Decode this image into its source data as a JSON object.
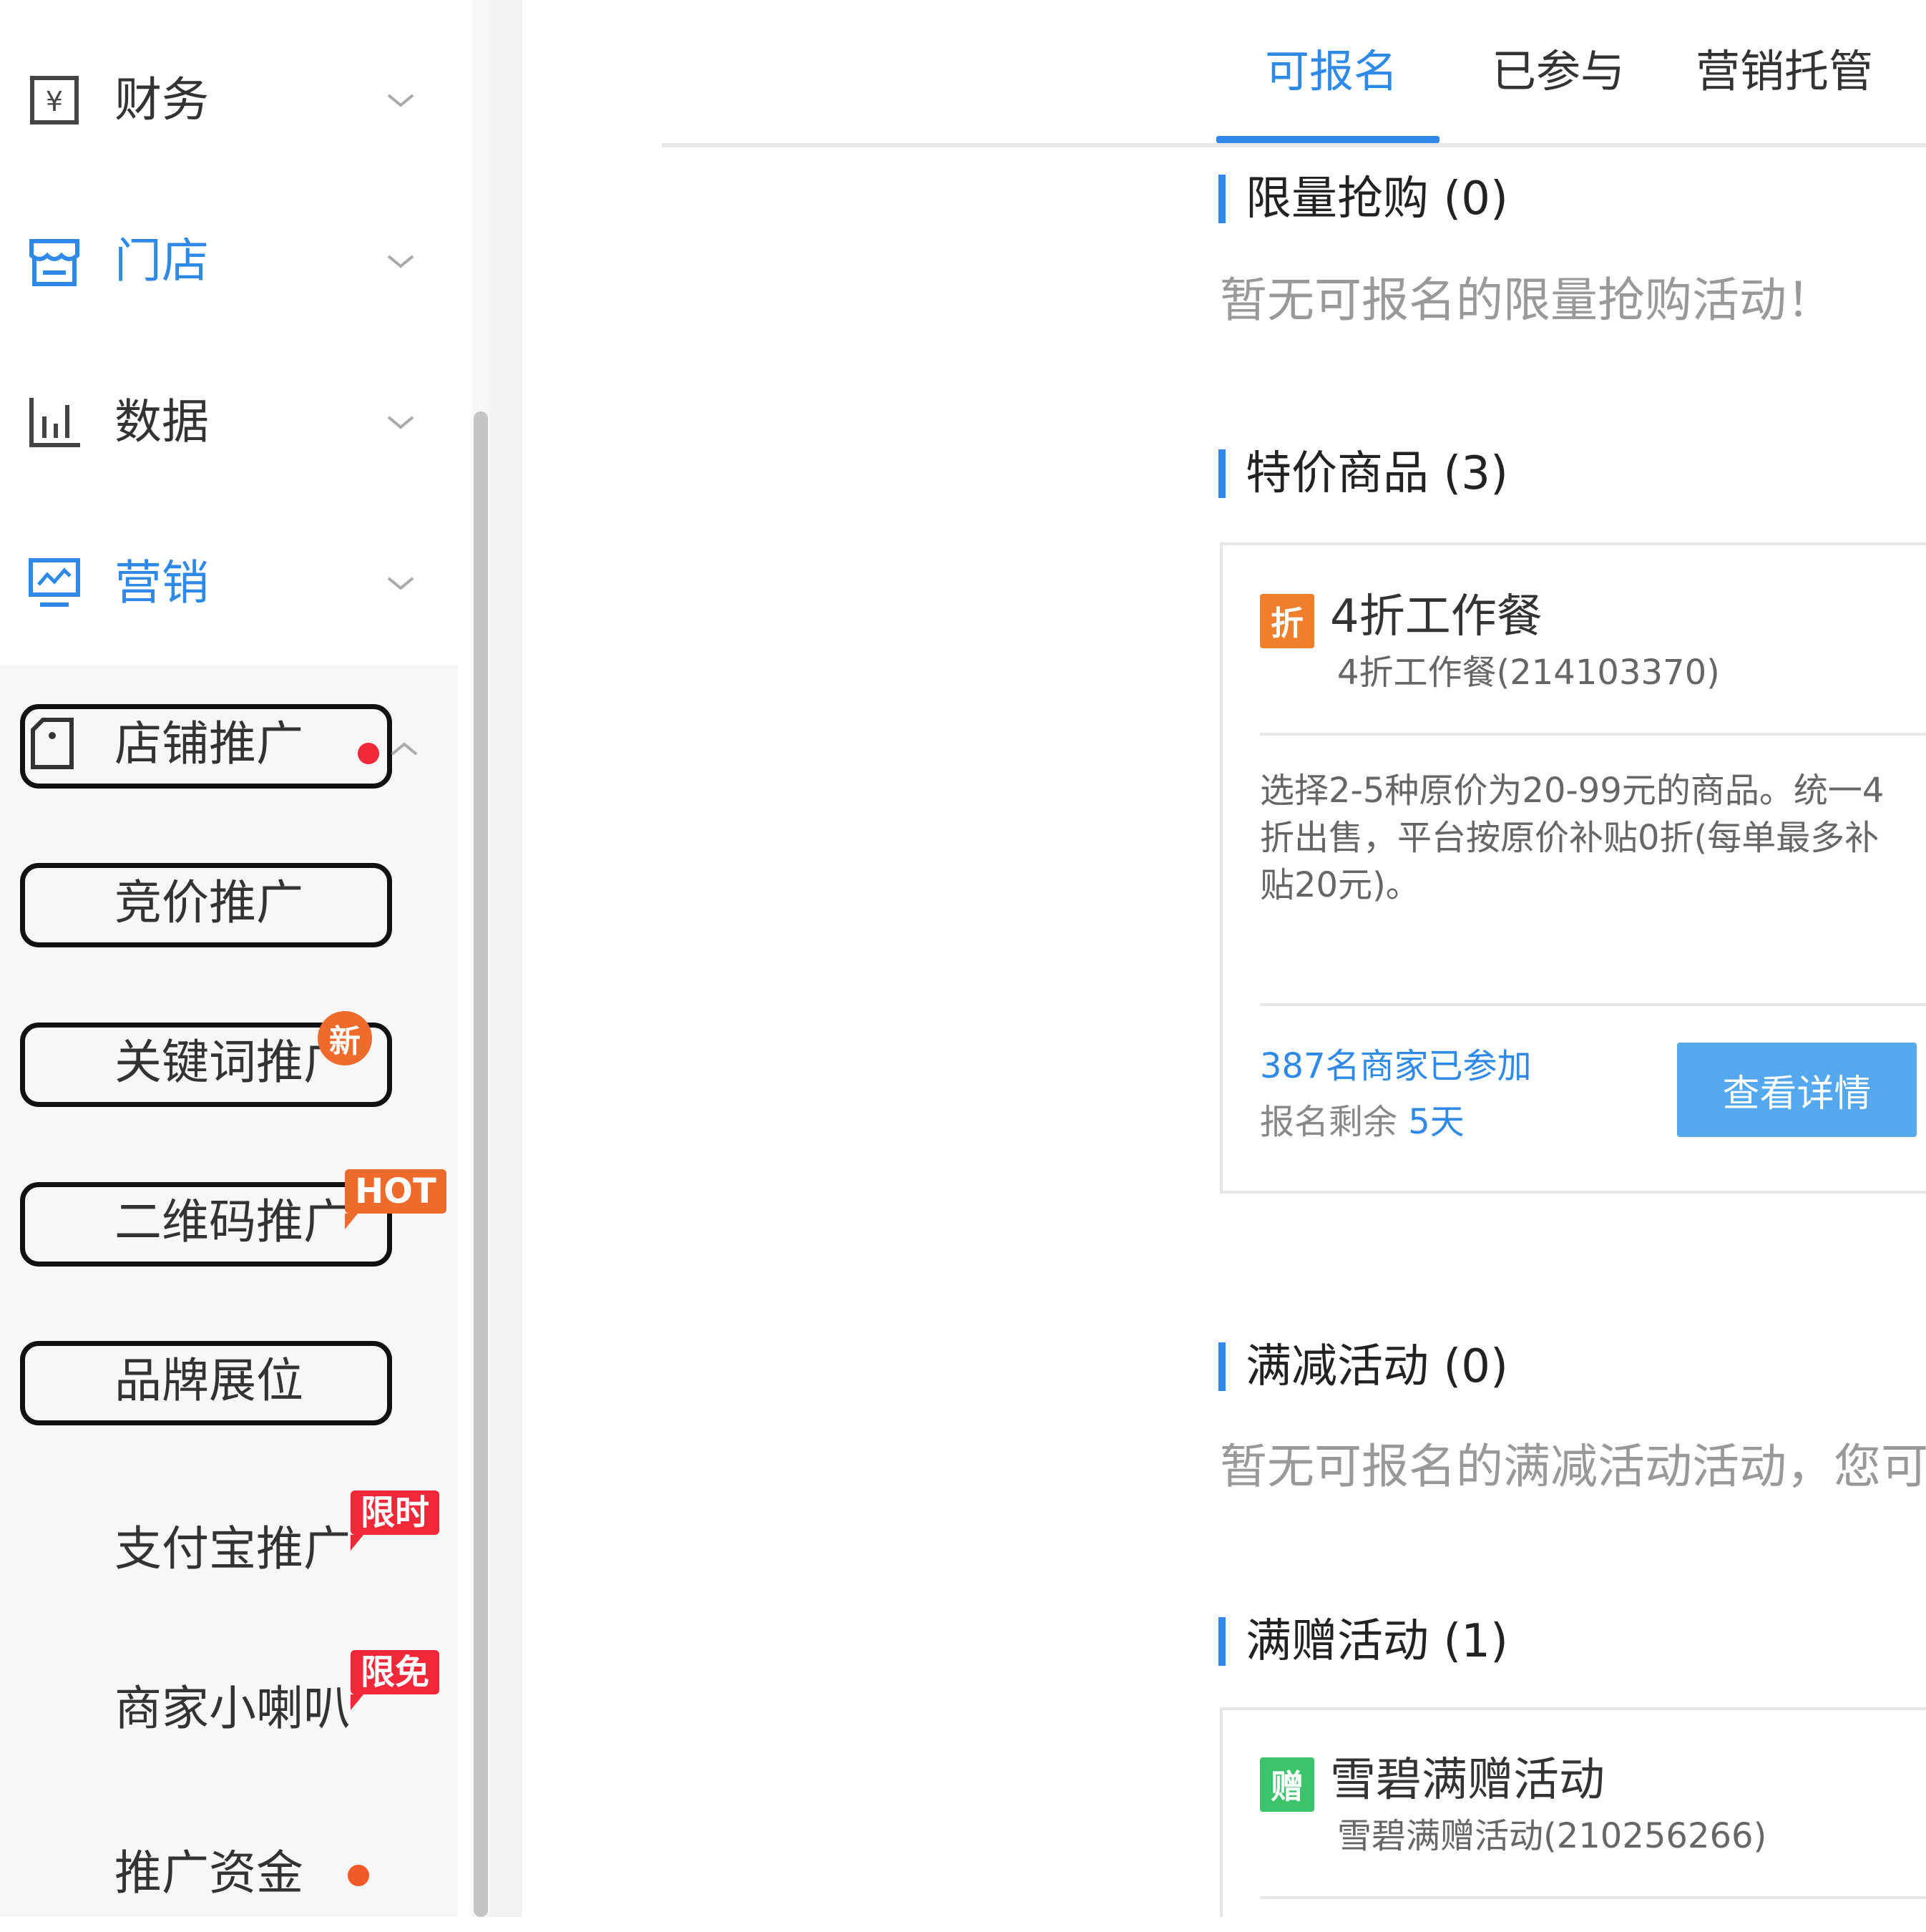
{
  "sidebar": {
    "menus": [
      {
        "label": "财务",
        "icon": "finance-icon"
      },
      {
        "label": "门店",
        "icon": "store-icon"
      },
      {
        "label": "数据",
        "icon": "data-chart-icon"
      },
      {
        "label": "营销",
        "icon": "marketing-monitor-icon"
      }
    ],
    "submenu": {
      "shop_promo": {
        "label": "店铺推广",
        "icon": "shop-tag-icon"
      },
      "bid_promo": {
        "label": "竞价推广"
      },
      "keyword_promo": {
        "label": "关键词推广",
        "badge": "新"
      },
      "qrcode_promo": {
        "label": "二维码推广",
        "badge": "HOT"
      },
      "brand_slot": {
        "label": "品牌展位"
      },
      "alipay_promo": {
        "label": "支付宝推广",
        "badge": "限时"
      },
      "merchant_speaker": {
        "label": "商家小喇叭",
        "badge": "限免"
      },
      "promo_funds": {
        "label": "推广资金"
      }
    },
    "colors": {
      "active": "#2e8ae6",
      "dot_red": "#f0283a",
      "badge_orange": "#ef6b2b"
    }
  },
  "tabs": [
    {
      "label": "可报名",
      "active": true
    },
    {
      "label": "已参与",
      "active": false
    },
    {
      "label": "营销托管",
      "active": false
    }
  ],
  "sections": {
    "flash_sale": {
      "title": "限量抢购 (0)",
      "empty": "暂无可报名的限量抢购活动！"
    },
    "special_price": {
      "title": "特价商品 (3)",
      "card": {
        "tag": "折",
        "name": "4折工作餐",
        "sub": "4折工作餐(214103370)",
        "desc": "选择2-5种原价为20-99元的商品。统一4折出售，平台按原价补贴0折(每单最多补贴20元)。",
        "joined": "387名商家已参加",
        "remaining_prefix": "报名剩余 ",
        "remaining_days": "5天",
        "button": "查看详情"
      }
    },
    "full_reduction": {
      "title": "满减活动 (0)",
      "empty": "暂无可报名的满减活动活动，您可"
    },
    "full_gift": {
      "title": "满赠活动 (1)",
      "card": {
        "tag": "赠",
        "name": "雪碧满赠活动",
        "sub": "雪碧满赠活动(210256266)"
      }
    }
  }
}
